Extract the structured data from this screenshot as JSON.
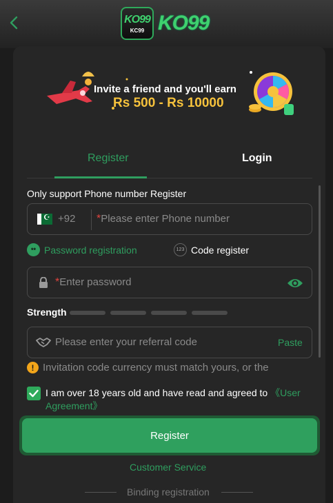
{
  "header": {
    "logo_badge_text": "KO99",
    "logo_badge_sub": "KC99",
    "logo_text": "KO99"
  },
  "banner": {
    "line1": "Invite a friend and you'll earn",
    "line2": "Rs 500 - Rs 10000"
  },
  "tabs": [
    {
      "label": "Register",
      "active": true
    },
    {
      "label": "Login",
      "active": false
    }
  ],
  "form": {
    "section_label": "Only support Phone number Register",
    "country_code": "+92",
    "phone_required_mark": "*",
    "phone_placeholder": "Please enter Phone number",
    "options": [
      {
        "label": "Password registration",
        "icon": "**",
        "selected": true
      },
      {
        "label": "Code register",
        "icon": "123",
        "selected": false
      }
    ],
    "password_required_mark": "*",
    "password_placeholder": "Enter password",
    "strength_label": "Strength",
    "strength_level": 0,
    "strength_segments": 4,
    "referral_placeholder": "Please enter your referral code",
    "paste_label": "Paste",
    "notice_icon": "!",
    "notice_text": "Invitation code currency must match yours, or the",
    "agree_checked": true,
    "agree_text": "I am over 18 years old and have read and agreed to ",
    "agree_link": "《User Agreement》",
    "register_button": "Register",
    "customer_service": "Customer Service",
    "binding_label": "Binding registration"
  },
  "colors": {
    "accent": "#2f9e5f",
    "background": "#1c1c1c",
    "card": "#262626",
    "warning": "#f2a51a"
  }
}
